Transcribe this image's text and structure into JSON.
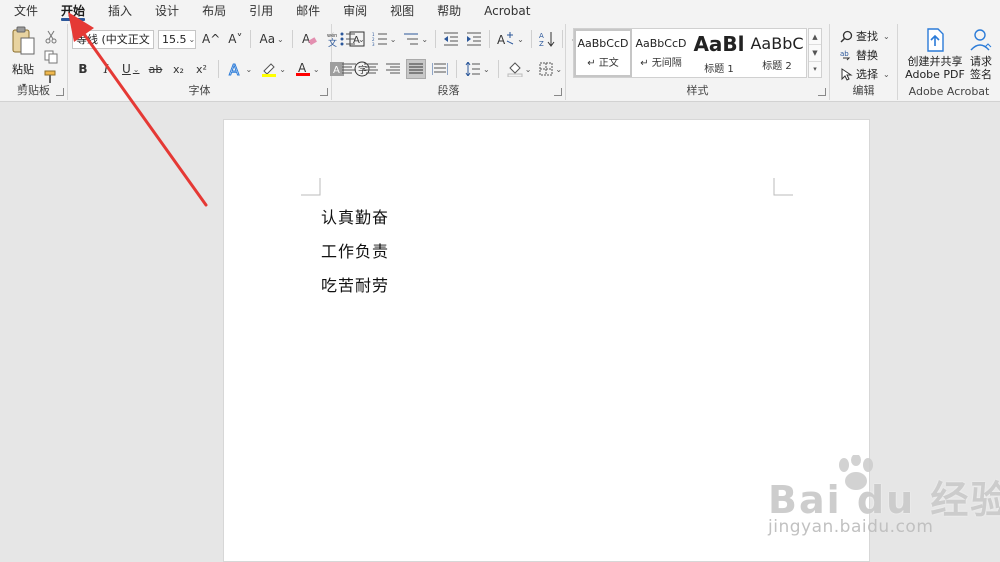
{
  "tabs": [
    {
      "label": "文件",
      "active": false
    },
    {
      "label": "开始",
      "active": true
    },
    {
      "label": "插入",
      "active": false
    },
    {
      "label": "设计",
      "active": false
    },
    {
      "label": "布局",
      "active": false
    },
    {
      "label": "引用",
      "active": false
    },
    {
      "label": "邮件",
      "active": false
    },
    {
      "label": "审阅",
      "active": false
    },
    {
      "label": "视图",
      "active": false
    },
    {
      "label": "帮助",
      "active": false
    },
    {
      "label": "Acrobat",
      "active": false
    }
  ],
  "clipboard": {
    "paste_label": "粘贴",
    "group_label": "剪贴板"
  },
  "font": {
    "name": "等线 (中文正文",
    "size": "15.5",
    "grow": "A^",
    "shrink": "A˅",
    "change_case": "Aa",
    "bold": "B",
    "italic": "I",
    "underline": "U",
    "strikethrough": "ab",
    "subscript": "x₂",
    "superscript": "x²",
    "group_label": "字体"
  },
  "paragraph": {
    "group_label": "段落"
  },
  "styles": {
    "items": [
      {
        "sample": "AaBbCcD",
        "name": "正文",
        "selected": true
      },
      {
        "sample": "AaBbCcD",
        "name": "无间隔",
        "selected": false
      },
      {
        "sample": "AaBl",
        "name": "标题 1",
        "selected": false
      },
      {
        "sample": "AaBbC",
        "name": "标题 2",
        "selected": false
      }
    ],
    "group_label": "样式"
  },
  "editing": {
    "find": "查找",
    "replace": "替换",
    "select": "选择",
    "group_label": "编辑"
  },
  "acrobat": {
    "create_share_line1": "创建并共享",
    "create_share_line2": "Adobe PDF",
    "request_sign_line1": "请求",
    "request_sign_line2": "签名",
    "group_label": "Adobe Acrobat"
  },
  "document": {
    "lines": [
      "认真勤奋",
      "工作负责",
      "吃苦耐劳"
    ]
  },
  "watermark": {
    "logo_text": "Bai du 经验",
    "url": "jingyan.baidu.com"
  },
  "colors": {
    "accent": "#2b579a",
    "annotation_arrow": "#e53935",
    "highlight": "#ffff00",
    "font_color": "#ff0000"
  }
}
